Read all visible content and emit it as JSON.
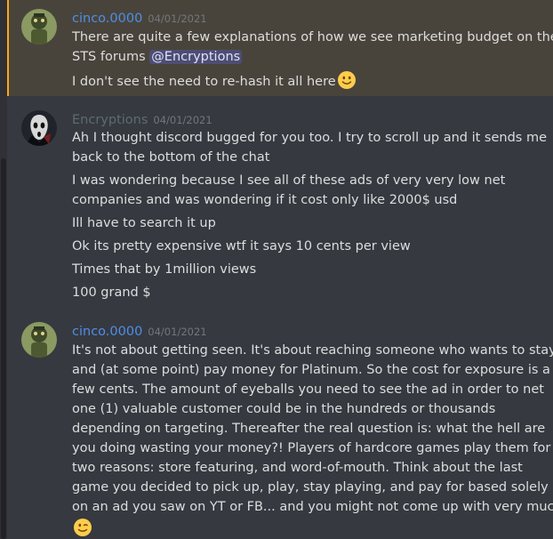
{
  "messages": [
    {
      "author": "cinco.0000",
      "author_color": "#4f8ee8",
      "timestamp": "04/01/2021",
      "mentioned": true,
      "lines": [
        {
          "text": "There are quite a few explanations of how we see marketing budget on the"
        },
        {
          "text": "STS forums ",
          "mention": "@Encryptions"
        },
        {
          "text": "I don't see the need to re-hash it all here",
          "emoji": "slightly-smiling-face-emoji"
        }
      ]
    },
    {
      "author": "Encryptions",
      "author_color": "#5d6b73",
      "timestamp": "04/01/2021",
      "mentioned": false,
      "lines": [
        {
          "text": "Ah I thought discord bugged for you too. I try to scroll up and it sends me"
        },
        {
          "text": "back to the bottom of the chat"
        },
        {
          "text": "I was wondering because I see all of these ads of very very low net"
        },
        {
          "text": "companies and was wondering if it cost only like 2000$ usd"
        },
        {
          "text": "Ill have to search it up"
        },
        {
          "text": "Ok its pretty expensive wtf it says 10 cents per view"
        },
        {
          "text": "Times that by 1million views"
        },
        {
          "text": "100 grand $"
        }
      ]
    },
    {
      "author": "cinco.0000",
      "author_color": "#4f8ee8",
      "timestamp": "04/01/2021",
      "mentioned": false,
      "lines": [
        {
          "text": "It's not about getting seen. It's about reaching someone who wants to stay"
        },
        {
          "text": "and (at some point) pay money for Platinum. So the cost for exposure is a"
        },
        {
          "text": "few cents. The amount of eyeballs you need to see the ad in order to net"
        },
        {
          "text": "one (1) valuable customer could be in the hundreds or thousands"
        },
        {
          "text": "depending on targeting. Thereafter the real question is: what the hell are"
        },
        {
          "text": "you doing wasting your money?! Players of hardcore games play them for"
        },
        {
          "text": "two reasons: store featuring, and word-of-mouth. Think about the last"
        },
        {
          "text": "game you decided to pick up, play, stay playing, and pay for based solely"
        },
        {
          "text": "on an ad you saw on YT or FB... and you might not come up with very much"
        },
        {
          "text": "",
          "emoji": "winking-face-emoji"
        }
      ]
    }
  ]
}
